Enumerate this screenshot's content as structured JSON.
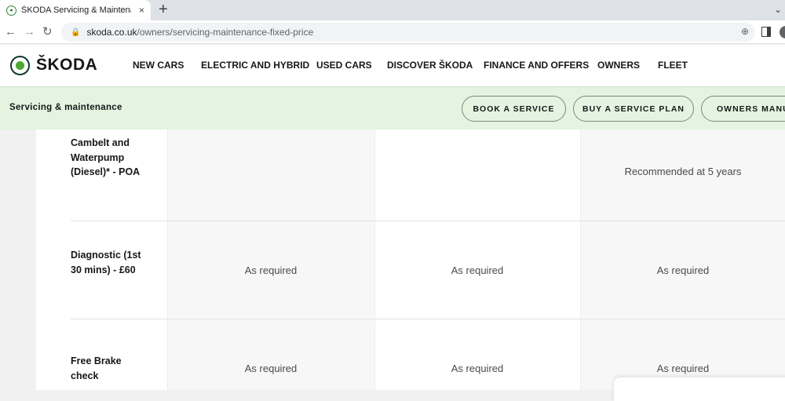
{
  "browser": {
    "tab_title": "ŠKODA Servicing & Maintenance",
    "tab_close": "×",
    "new_tab": "+",
    "url_host": "skoda.co.uk",
    "url_path": "/owners/servicing-maintenance-fixed-price"
  },
  "header": {
    "logo_text": "ŠKODA",
    "nav": [
      "NEW CARS",
      "ELECTRIC AND HYBRID",
      "USED CARS",
      "DISCOVER ŠKODA",
      "FINANCE AND OFFERS",
      "OWNERS",
      "FLEET"
    ]
  },
  "subnav": {
    "title": "Servicing & maintenance",
    "buttons": [
      "BOOK A SERVICE",
      "BUY A SERVICE PLAN",
      "OWNERS MANUAL"
    ]
  },
  "table": {
    "rows": [
      {
        "label": "Cambelt and Waterpump (Diesel)* - POA",
        "cells": [
          "",
          "",
          "Recommended at 5 years"
        ]
      },
      {
        "label": "Diagnostic (1st 30 mins) - £60",
        "cells": [
          "As required",
          "As required",
          "As required"
        ]
      },
      {
        "label": "Free Brake check",
        "cells": [
          "As required",
          "As required",
          "As required"
        ]
      }
    ]
  },
  "icons": {
    "back": "back-arrow-icon",
    "forward": "forward-arrow-icon",
    "reload": "reload-icon",
    "lock": "lock-icon",
    "zoom": "zoom-icon",
    "logo": "skoda-logo-icon"
  },
  "colors": {
    "subnav_bg": "#e4f4e1",
    "brand_green": "#4ba82e"
  }
}
